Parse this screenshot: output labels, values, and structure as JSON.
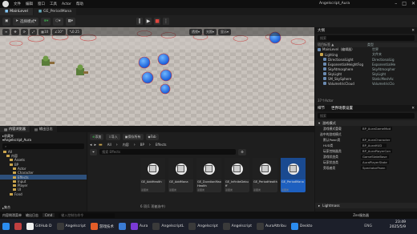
{
  "menubar": {
    "items": [
      "文件",
      "编辑",
      "窗口",
      "工具",
      "Actor",
      "帮助"
    ],
    "project": "Angelscript_Aura"
  },
  "tabs": [
    {
      "label": "MainLevel"
    },
    {
      "label": "GE_PeriodMana"
    }
  ],
  "toolbar": {
    "mode_label": "选择模式",
    "buttons": [
      "save-icon",
      "add-icon",
      "blueprint-icon",
      "cinematics-icon"
    ]
  },
  "viewport": {
    "perspective": "透视",
    "lit": "光照",
    "display": "显示",
    "snap_angle": "10°",
    "snap_scale": "0.25",
    "grid": "10"
  },
  "outliner": {
    "title": "大纲",
    "search_placeholder": "搜索",
    "col_label": "项目标签 ▲",
    "col_type": "类型",
    "rows": [
      {
        "name": "MainLevel（编辑器）",
        "type": "世界"
      },
      {
        "name": "Lighting",
        "type": "文件夹"
      },
      {
        "name": "DirectionalLight",
        "type": "DirectionalLig"
      },
      {
        "name": "ExponentialHeightFog",
        "type": "ExponentialHe"
      },
      {
        "name": "SkyAtmosphere",
        "type": "SkyAtmospher"
      },
      {
        "name": "SkyLight",
        "type": "SkyLight"
      },
      {
        "name": "SM_SkySphere",
        "type": "StaticMeshAc"
      },
      {
        "name": "VolumetricCloud",
        "type": "VolumetricClo"
      }
    ],
    "count": "37个Actor"
  },
  "details": {
    "tab1": "细节",
    "tab2": "世界场景设置",
    "search_placeholder": "搜索",
    "sections": [
      "游戏模式",
      "Lightmass",
      "世界"
    ],
    "rows": [
      {
        "label": "游戏模式重载",
        "value": "BP_AuraGameMod"
      },
      {
        "label": "选中的游戏模式",
        "value": ""
      },
      {
        "label": "默认Pawn类",
        "value": "BP_AuraCharacter"
      },
      {
        "label": "HUD类",
        "value": "BP_AuraHUD"
      },
      {
        "label": "玩家控制器类",
        "value": "BP_AuraPlayerCon"
      },
      {
        "label": "游戏状态类",
        "value": "GameStateBase"
      },
      {
        "label": "玩家状态类",
        "value": "AuraPlayerState"
      },
      {
        "label": "旁观者类",
        "value": "SpectatorPawn"
      }
    ]
  },
  "content_browser": {
    "tabs": [
      "内容浏览器",
      "输出日志"
    ],
    "favorites": "收藏夹",
    "project": "Angelscript_Aura",
    "folders": [
      {
        "label": "All",
        "depth": 0
      },
      {
        "label": "内容",
        "depth": 1
      },
      {
        "label": "Assets",
        "depth": 2
      },
      {
        "label": "BP",
        "depth": 2
      },
      {
        "label": "Actor",
        "depth": 3
      },
      {
        "label": "Character",
        "depth": 3
      },
      {
        "label": "Effects",
        "depth": 3,
        "selected": true
      },
      {
        "label": "Input",
        "depth": 3
      },
      {
        "label": "Player",
        "depth": 3
      },
      {
        "label": "UI",
        "depth": 3
      },
      {
        "label": "Fond",
        "depth": 2
      }
    ],
    "collections": "集合",
    "add_label": "添加",
    "import_label": "导入",
    "save_all_label": "保存所有",
    "fab_label": "Fab",
    "path": [
      "All",
      "内容",
      "BP",
      "Effects"
    ],
    "filter_label": "筛选器",
    "search_placeholder": "搜索 Effects",
    "assets": [
      {
        "name": "GE_AddHealth",
        "type": "蓝图类"
      },
      {
        "name": "GE_AddMana",
        "type": "蓝图类"
      },
      {
        "name": "GE_DurationMaxHealth",
        "type": "蓝图类"
      },
      {
        "name": "GE_InfiniteDebuff",
        "type": "蓝图类"
      },
      {
        "name": "GE_PeriodHealth",
        "type": "蓝图类"
      },
      {
        "name": "GE_PeriodMana",
        "type": "蓝图类",
        "selected": true
      }
    ],
    "count": "6 项(1 项被选中)"
  },
  "statusbar": {
    "items": [
      "内容侧滑菜单",
      "输出日志",
      "Cmd",
      "输入控制台命令"
    ],
    "right": "Zen服务器"
  },
  "taskbar": {
    "apps": [
      "",
      "GitHub D",
      "Angelscript",
      "游戏技术",
      "",
      "Aura",
      "AngelscriptL",
      "Angelscript",
      "Angelscript",
      "AuraAttribu",
      "Deskto"
    ],
    "lang": "ENG",
    "time": "23:49",
    "date": "2025/5/9"
  }
}
